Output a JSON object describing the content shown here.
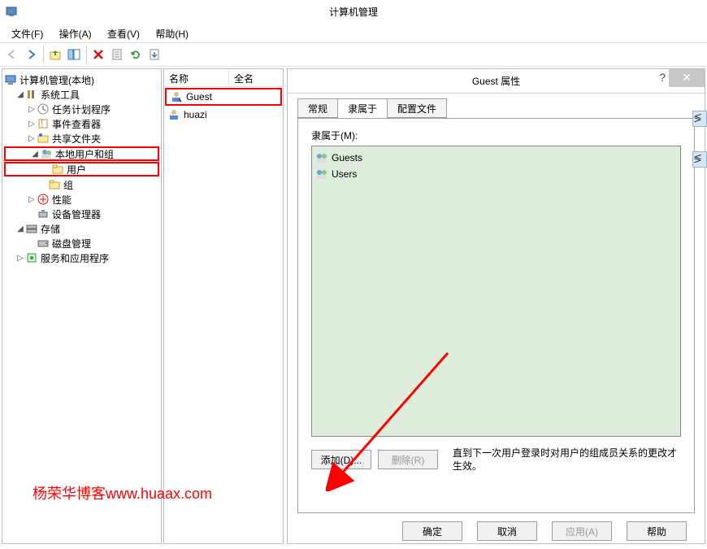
{
  "window": {
    "title": "计算机管理"
  },
  "menu": {
    "file": "文件(F)",
    "action": "操作(A)",
    "view": "查看(V)",
    "help": "帮助(H)"
  },
  "tree": {
    "root": "计算机管理(本地)",
    "sys_tools": "系统工具",
    "task_sched": "任务计划程序",
    "event_viewer": "事件查看器",
    "shared": "共享文件夹",
    "local_users": "本地用户和组",
    "users": "用户",
    "groups": "组",
    "perf": "性能",
    "devmgr": "设备管理器",
    "storage": "存储",
    "diskmgmt": "磁盘管理",
    "services_apps": "服务和应用程序"
  },
  "list": {
    "col_name": "名称",
    "col_full": "全名",
    "items": [
      {
        "name": "Guest"
      },
      {
        "name": "huazi"
      }
    ]
  },
  "dialog": {
    "title": "Guest 属性",
    "tabs": {
      "general": "常规",
      "memberof": "隶属于",
      "profile": "配置文件"
    },
    "member_label": "隶属于(M):",
    "members": [
      "Guests",
      "Users"
    ],
    "add": "添加(D)...",
    "remove": "删除(R)",
    "note": "直到下一次用户登录时对用户的组成员关系的更改才生效。",
    "ok": "确定",
    "cancel": "取消",
    "apply": "应用(A)",
    "help": "帮助"
  },
  "sidestrip": {
    "a": "≶操作",
    "b": "≶操作"
  },
  "watermark": "杨荣华博客www.huaax.com"
}
